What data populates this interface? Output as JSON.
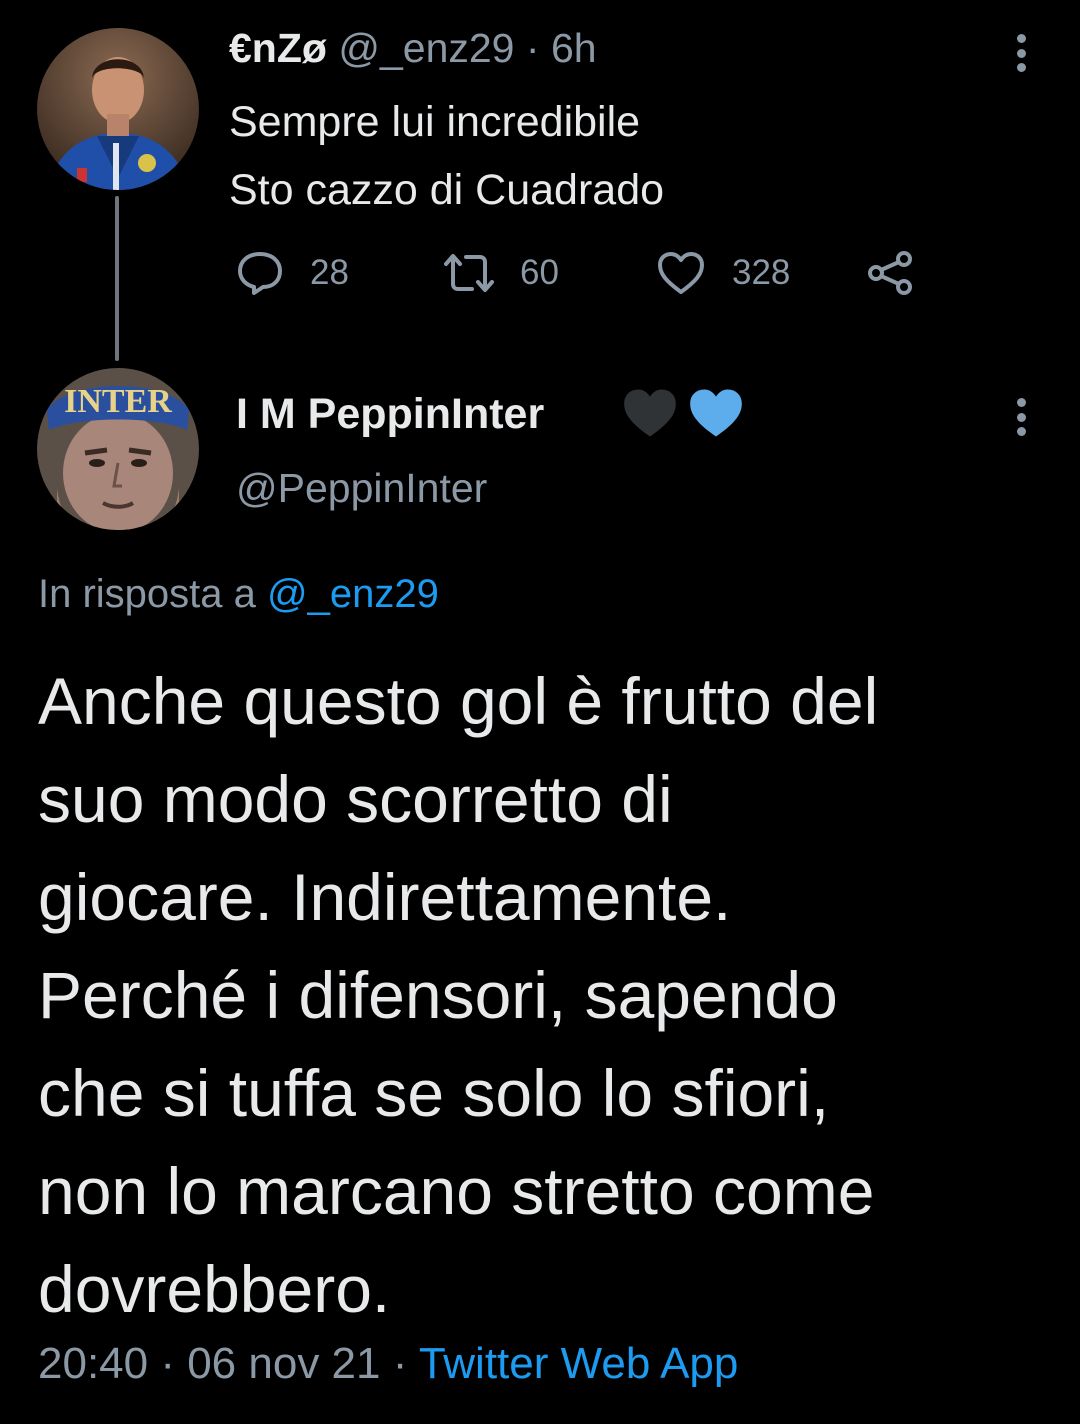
{
  "tweet1": {
    "display_name": "€nZø",
    "handle": "@_enz29",
    "separator": "·",
    "time": "6h",
    "text_lines": [
      "Sempre lui incredibile",
      "Sto cazzo di Cuadrado"
    ],
    "replies": "28",
    "retweets": "60",
    "likes": "328"
  },
  "tweet2": {
    "display_name": "I M PeppinInter",
    "emoji": [
      "black-heart",
      "blue-heart"
    ],
    "handle": "@PeppinInter",
    "reply_prefix": "In risposta a",
    "reply_to": "@_enz29",
    "text_lines": [
      "Anche questo gol è frutto del",
      "suo modo scorretto di",
      "giocare. Indirettamente.",
      "Perché i difensori, sapendo",
      "che si tuffa se solo lo sfiori,",
      "non lo marcano stretto come",
      "dovrebbero."
    ],
    "timestamp": "20:40 · 06 nov 21",
    "separator": "·",
    "source": "Twitter Web App",
    "avatar_cap_text": "INTER"
  },
  "colors": {
    "background": "#000000",
    "text": "#e7e9ea",
    "muted": "#8b98a5",
    "link": "#1d9bf0"
  }
}
